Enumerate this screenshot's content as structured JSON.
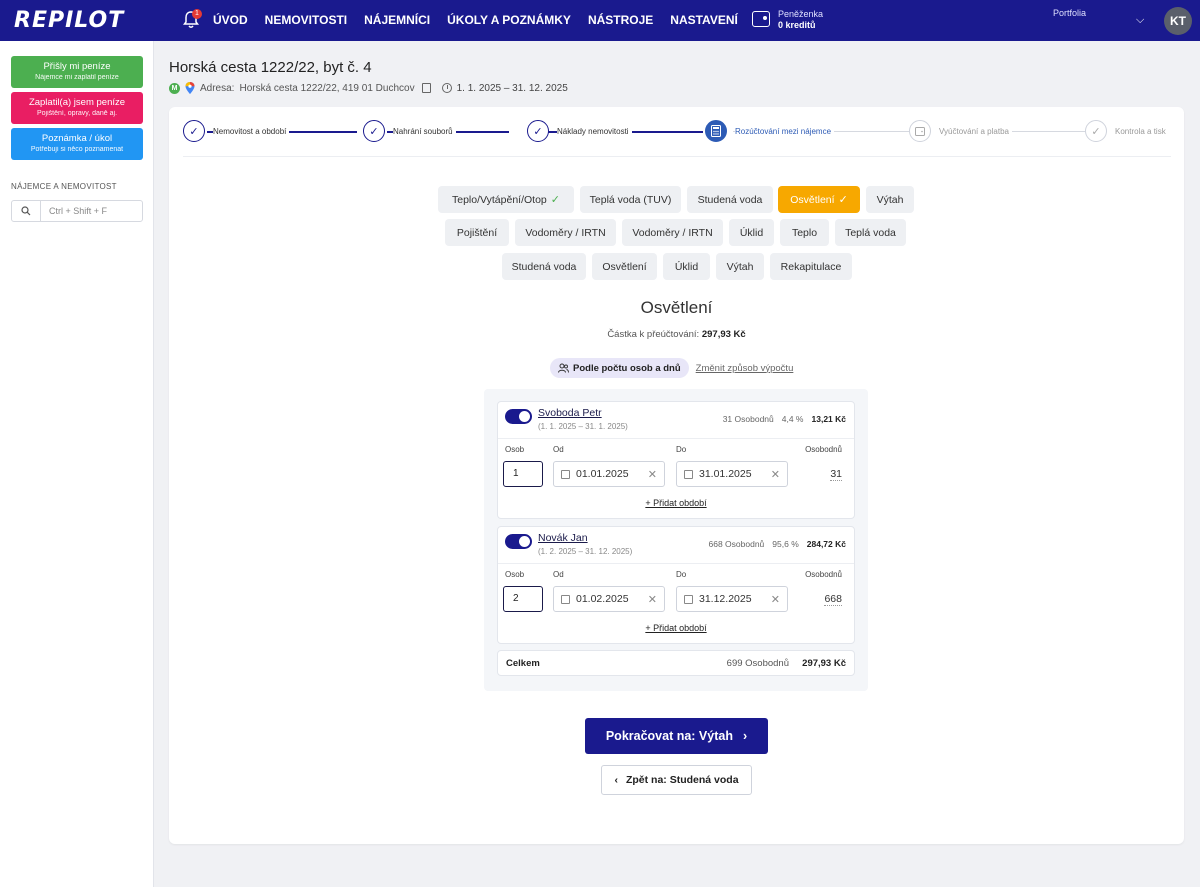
{
  "brand": {
    "logo": "REPILOT",
    "accent": "#1a1a8e",
    "notification_count": "1"
  },
  "nav": [
    "ÚVOD",
    "NEMOVITOSTI",
    "NÁJEMNÍCI",
    "ÚKOLY A POZNÁMKY",
    "NÁSTROJE",
    "NASTAVENÍ"
  ],
  "wallet": {
    "label": "Peněženka",
    "value": "0 kreditů"
  },
  "portfolio": {
    "label": "Portfolia"
  },
  "user": {
    "initials": "KT"
  },
  "sidebar": {
    "btn_received": {
      "title": "Přišly mi peníze",
      "subtitle": "Nájemce mi zaplatil peníze"
    },
    "btn_paid": {
      "title": "Zaplatil(a) jsem peníze",
      "subtitle": "Pojištění, opravy, daně aj."
    },
    "btn_note": {
      "title": "Poznámka / úkol",
      "subtitle": "Potřebuji si něco poznamenat"
    },
    "section_title": "NÁJEMCE A NEMOVITOST",
    "search_placeholder": "Ctrl + Shift + F"
  },
  "page": {
    "title": "Horská cesta 1222/22, byt č. 4",
    "badge": "M",
    "address_label": "Adresa:",
    "address": "Horská cesta 1222/22, 419 01 Duchcov",
    "period": "1. 1. 2025 – 31. 12. 2025"
  },
  "steps": [
    {
      "label": "Nemovitost a období",
      "state": "done"
    },
    {
      "label": "Nahrání souborů",
      "state": "done"
    },
    {
      "label": "Náklady nemovitosti",
      "state": "done"
    },
    {
      "label": "Rozúčtování mezi nájemce",
      "state": "active"
    },
    {
      "label": "Vyúčtování a platba",
      "state": "future"
    },
    {
      "label": "Kontrola a tisk",
      "state": "future"
    }
  ],
  "tabs": {
    "row1": [
      {
        "label": "Teplo/Vytápění/Otop",
        "check": "✓"
      },
      {
        "label": "Teplá voda (TUV)"
      },
      {
        "label": "Studená voda"
      },
      {
        "label": "Osvětlení",
        "check": "✓",
        "active": true
      },
      {
        "label": "Výtah"
      }
    ],
    "row2": [
      {
        "label": "Pojištění"
      },
      {
        "label": "Vodoměry / IRTN"
      },
      {
        "label": "Vodoměry / IRTN"
      },
      {
        "label": "Úklid"
      },
      {
        "label": "Teplo"
      },
      {
        "label": "Teplá voda"
      }
    ],
    "row3": [
      {
        "label": "Studená voda"
      },
      {
        "label": "Osvětlení"
      },
      {
        "label": "Úklid"
      },
      {
        "label": "Výtah"
      },
      {
        "label": "Rekapitulace"
      }
    ],
    "active_color": "#f7a800"
  },
  "section": {
    "title": "Osvětlení",
    "amount_label": "Částka k přeúčtování:",
    "amount_value": "297,93 Kč",
    "method_label": "Podle počtu osob a dnů",
    "change_method": "Změnit způsob výpočtu"
  },
  "field_labels": {
    "persons": "Osob",
    "from": "Od",
    "to": "Do",
    "days": "Osobodnů"
  },
  "tenants": [
    {
      "name": "Svoboda Petr",
      "dates": "(1. 1. 2025 – 31. 1. 2025)",
      "persondays": "31 Osobodnů",
      "percent": "4,4 %",
      "amount": "13,21 Kč",
      "persons": "1",
      "from": "01.01.2025",
      "to": "31.01.2025",
      "days": "31",
      "add_period": "+ Přidat období"
    },
    {
      "name": "Novák Jan",
      "dates": "(1. 2. 2025 – 31. 12. 2025)",
      "persondays": "668 Osobodnů",
      "percent": "95,6 %",
      "amount": "284,72 Kč",
      "persons": "2",
      "from": "01.02.2025",
      "to": "31.12.2025",
      "days": "668",
      "add_period": "+ Přidat období"
    }
  ],
  "total": {
    "label": "Celkem",
    "persondays": "699 Osobodnů",
    "amount": "297,93 Kč"
  },
  "buttons": {
    "continue": "Pokračovat na: Výtah",
    "back": "Zpět na: Studená voda"
  }
}
